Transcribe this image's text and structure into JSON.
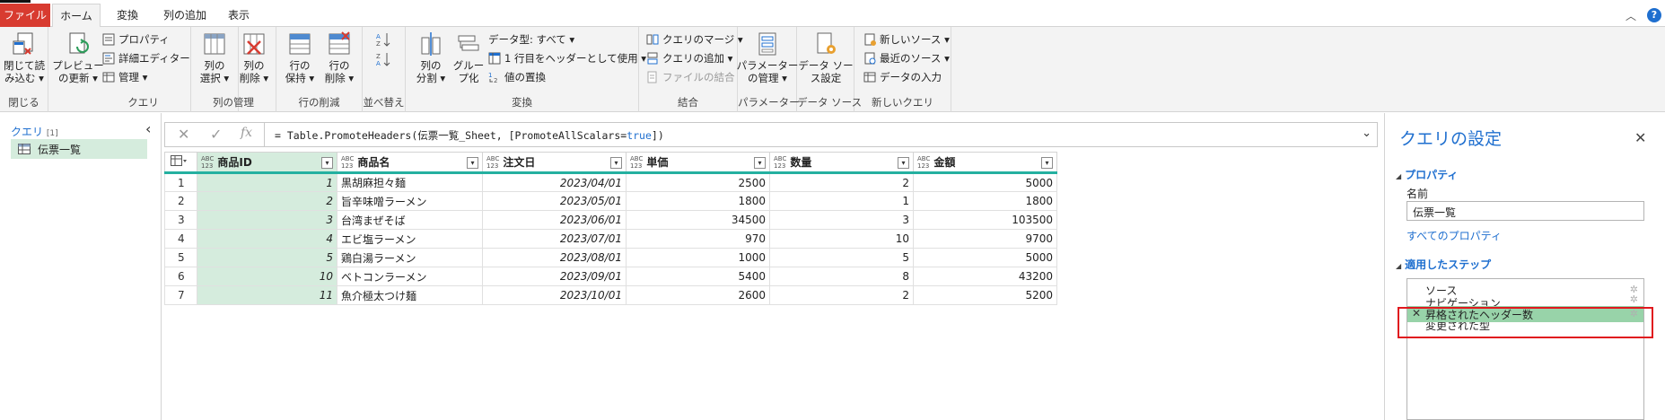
{
  "tabs": {
    "file": "ファイル",
    "home": "ホーム",
    "transform": "変換",
    "add_column": "列の追加",
    "view": "表示"
  },
  "ribbon": {
    "close": {
      "btn1": "閉じて読",
      "btn1b": "み込む ▾",
      "group": "閉じる"
    },
    "query": {
      "preview1": "プレビュー",
      "preview2": "の更新 ▾",
      "properties": "プロパティ",
      "advanced_editor": "詳細エディター",
      "manage": "管理 ▾",
      "group": "クエリ"
    },
    "manage_columns": {
      "choose1": "列の",
      "choose2": "選択 ▾",
      "remove1": "列の",
      "remove2": "削除 ▾",
      "group": "列の管理"
    },
    "reduce_rows": {
      "keep1": "行の",
      "keep2": "保持 ▾",
      "remove1": "行の",
      "remove2": "削除 ▾",
      "group": "行の削減"
    },
    "sort": {
      "group": "並べ替え"
    },
    "transform": {
      "split1": "列の",
      "split2": "分割 ▾",
      "groupby1": "グルー",
      "groupby2": "プ化",
      "datatype": "データ型: すべて ▾",
      "first_row_header": "1 行目をヘッダーとして使用 ▾",
      "replace_values": "値の置換",
      "group": "変換"
    },
    "combine": {
      "merge": "クエリのマージ ▾",
      "append": "クエリの追加 ▾",
      "combine_files": "ファイルの結合",
      "group": "結合"
    },
    "parameters": {
      "btn1": "パラメーター",
      "btn2": "の管理 ▾",
      "group": "パラメーター"
    },
    "data_source": {
      "btn1": "データ ソー",
      "btn2": "ス設定",
      "group": "データ ソース"
    },
    "new_query": {
      "new_source": "新しいソース ▾",
      "recent_sources": "最近のソース ▾",
      "enter_data": "データの入力",
      "group": "新しいクエリ"
    }
  },
  "left_pane": {
    "title": "クエリ",
    "count": "[1]",
    "items": [
      {
        "label": "伝票一覧"
      }
    ]
  },
  "formula_bar": {
    "prefix": "= Table.PromoteHeaders(伝票一覧_Sheet, [PromoteAllScalars=",
    "keyword": "true",
    "suffix": "])"
  },
  "table": {
    "type_label_top": "ABC",
    "type_label_bottom": "123",
    "columns": [
      "商品ID",
      "商品名",
      "注文日",
      "単価",
      "数量",
      "金額"
    ],
    "rows": [
      {
        "n": "1",
        "id": "1",
        "name": "黒胡麻担々麺",
        "date": "2023/04/01",
        "price": "2500",
        "qty": "2",
        "amount": "5000"
      },
      {
        "n": "2",
        "id": "2",
        "name": "旨辛味噌ラーメン",
        "date": "2023/05/01",
        "price": "1800",
        "qty": "1",
        "amount": "1800"
      },
      {
        "n": "3",
        "id": "3",
        "name": "台湾まぜそば",
        "date": "2023/06/01",
        "price": "34500",
        "qty": "3",
        "amount": "103500"
      },
      {
        "n": "4",
        "id": "4",
        "name": "エビ塩ラーメン",
        "date": "2023/07/01",
        "price": "970",
        "qty": "10",
        "amount": "9700"
      },
      {
        "n": "5",
        "id": "5",
        "name": "鶏白湯ラーメン",
        "date": "2023/08/01",
        "price": "1000",
        "qty": "5",
        "amount": "5000"
      },
      {
        "n": "6",
        "id": "10",
        "name": "ベトコンラーメン",
        "date": "2023/09/01",
        "price": "5400",
        "qty": "8",
        "amount": "43200"
      },
      {
        "n": "7",
        "id": "11",
        "name": "魚介極太つけ麺",
        "date": "2023/10/01",
        "price": "2600",
        "qty": "2",
        "amount": "5200"
      }
    ]
  },
  "settings": {
    "title": "クエリの設定",
    "properties_header": "プロパティ",
    "name_label": "名前",
    "name_value": "伝票一覧",
    "all_properties_link": "すべてのプロパティ",
    "steps_header": "適用したステップ",
    "steps": [
      "ソース",
      "ナビゲーション",
      "昇格されたヘッダー数",
      "変更された型"
    ],
    "active_step_index": 2
  },
  "colors": {
    "file_tab": "#d83b30",
    "accent_blue": "#1f6fcf",
    "key_column_fill": "#d5ecdd",
    "active_step_fill": "#98d3a9",
    "header_underline": "#24b0a0",
    "highlight_border": "#e0181e"
  }
}
